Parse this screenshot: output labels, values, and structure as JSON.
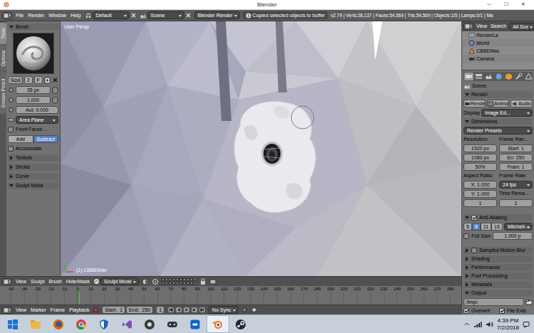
{
  "window": {
    "title": "Blender",
    "controls": [
      "—",
      "☐",
      "✕"
    ]
  },
  "info_header": {
    "menus": [
      "File",
      "Render",
      "Window",
      "Help"
    ],
    "layout": "Default",
    "scene": "Scene",
    "engine": "Blender Render",
    "message": "Copied selected objects to buffer",
    "stats": "v2.79 | Verts:28,137 | Faces:54,569 | Tris:54,569 | Objects:1/5 | Lamps:0/1 | Ma"
  },
  "tool_shelf": {
    "tabs": [
      {
        "label": "Tools",
        "selected": true
      },
      {
        "label": "Options",
        "selected": false
      },
      {
        "label": "Grease Pencil",
        "selected": false
      }
    ],
    "brush_panel": {
      "label": "Brush",
      "expanded": true
    },
    "brush": {
      "name": "Scul",
      "users": "2",
      "fake_user": "F"
    },
    "radius": "35 px",
    "strength": "1.000",
    "autosmooth": "Aut: 0.000",
    "plane": "Area Plane",
    "front_faces": {
      "label": "Front Faces ...",
      "checked": false
    },
    "direction": [
      {
        "label": "Add",
        "selected": false
      },
      {
        "label": "Subtract",
        "selected": true
      }
    ],
    "accumulate": {
      "label": "Accumulate",
      "checked": false
    },
    "subpanels": [
      {
        "label": "Texture",
        "expanded": false
      },
      {
        "label": "Stroke",
        "expanded": false
      },
      {
        "label": "Curve",
        "expanded": false
      }
    ],
    "mode_panel": {
      "label": "Sculpt Mode",
      "expanded": true
    }
  },
  "viewport": {
    "view_name": "User Persp",
    "object_label": "(1) CBBEMax"
  },
  "viewport_header": {
    "menus": [
      "View",
      "Sculpt",
      "Brush",
      "Hide/Mask"
    ],
    "mode": "Sculpt Mode"
  },
  "timeline": {
    "ticks": [
      "-50",
      "-40",
      "-30",
      "-20",
      "-10",
      "0",
      "10",
      "20",
      "30",
      "40",
      "50",
      "60",
      "70",
      "80",
      "90",
      "100",
      "110",
      "120",
      "130",
      "140",
      "150",
      "160",
      "170",
      "180",
      "190",
      "200",
      "210",
      "220",
      "230",
      "240",
      "250",
      "260",
      "270",
      "280"
    ]
  },
  "timeline_header": {
    "menus": [
      "View",
      "Marker",
      "Frame",
      "Playback"
    ],
    "start_label": "Start:",
    "start": "1",
    "end_label": "End:",
    "end": "250",
    "current": "1",
    "sync": "No Sync"
  },
  "outliner": {
    "menus": [
      "View",
      "Search"
    ],
    "filter": "All Sce",
    "items": [
      {
        "label": "RenderLa",
        "kind": "renderlayers"
      },
      {
        "label": "World",
        "kind": "world"
      },
      {
        "label": "CBBEMax",
        "kind": "mesh"
      },
      {
        "label": "Camera",
        "kind": "camera"
      }
    ]
  },
  "properties": {
    "tabs": [
      {
        "kind": "render",
        "selected": true
      },
      {
        "kind": "layers",
        "selected": false
      },
      {
        "kind": "scene",
        "selected": false
      },
      {
        "kind": "world",
        "selected": false
      },
      {
        "kind": "object",
        "selected": false
      },
      {
        "kind": "modifiers",
        "selected": false
      },
      {
        "kind": "data",
        "selected": false
      },
      {
        "kind": "material",
        "selected": false
      }
    ],
    "context": "Scene",
    "render": {
      "label": "Render",
      "expanded": true,
      "buttons": [
        "Rende",
        "Anima",
        "Audio"
      ],
      "display_label": "Display",
      "display": "Image Ed..."
    },
    "dimensions": {
      "label": "Dimensions",
      "expanded": true,
      "presets": "Render Presets",
      "resolution_label": "Resolution:",
      "frame_range_label": "Frame Ran...",
      "res_x": "1920 px",
      "frame_start": "Start: 1",
      "res_y": "1080 px",
      "frame_end": "En: 250",
      "res_pct": "50%",
      "frame_step": "Fram: 1",
      "aspect_label": "Aspect Ratio:",
      "frame_rate_label": "Frame Rate:",
      "aspect_x": "X: 1.000",
      "frame_rate": "24 fps",
      "aspect_y": "Y: 1.000",
      "remap_label": "Time Rema...",
      "remap_old": "1",
      "remap_new": "1"
    },
    "anti_aliasing": {
      "label": "Anti-Aliasing",
      "expanded": true,
      "checked": true,
      "samples": [
        {
          "label": "5",
          "selected": false
        },
        {
          "label": "8",
          "selected": true
        },
        {
          "label": "11",
          "selected": false
        },
        {
          "label": "16",
          "selected": false
        }
      ],
      "filter": "Mitchell-...",
      "full_sample": {
        "label": "Full Sam",
        "checked": false
      },
      "size": "1.000 p"
    },
    "motion_blur": {
      "label": "Sampled Motion Blur",
      "expanded": false,
      "checked": false
    },
    "panels": [
      {
        "label": "Shading",
        "expanded": false
      },
      {
        "label": "Performance",
        "expanded": false
      },
      {
        "label": "Post Processing",
        "expanded": false
      },
      {
        "label": "Metadata",
        "expanded": false
      }
    ],
    "output": {
      "label": "Output",
      "expanded": true,
      "path": "/tmp\\",
      "overwrite": {
        "label": "Overwrit",
        "checked": true
      },
      "file_ext": {
        "label": "File Exte",
        "checked": true
      }
    }
  },
  "taskbar": {
    "apps": [
      {
        "kind": "explorer",
        "active": false
      },
      {
        "kind": "firefox",
        "active": false
      },
      {
        "kind": "chrome",
        "active": false
      },
      {
        "kind": "shield",
        "active": false
      },
      {
        "kind": "visualstudio",
        "active": false
      },
      {
        "kind": "disc",
        "active": false
      },
      {
        "kind": "gamepad",
        "active": false
      },
      {
        "kind": "blueapp",
        "active": false
      },
      {
        "kind": "blender",
        "active": true
      },
      {
        "kind": "steam",
        "active": false
      }
    ],
    "time": "4:39 PM",
    "date": "7/2/2018"
  }
}
